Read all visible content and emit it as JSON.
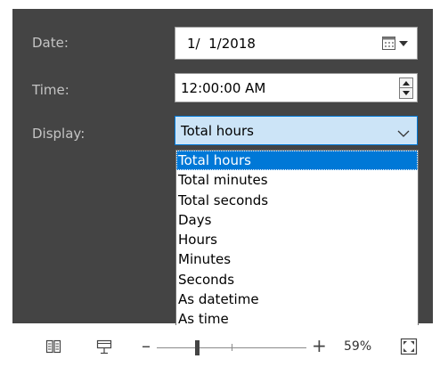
{
  "form": {
    "date_label": "Date:",
    "date_value": "1/  1/2018",
    "time_label": "Time:",
    "time_value": "12:00:00 AM",
    "display_label": "Display:",
    "display_value": "Total hours",
    "display_options": [
      "Total hours",
      "Total minutes",
      "Total seconds",
      "Days",
      "Hours",
      "Minutes",
      "Seconds",
      "As datetime",
      "As time"
    ]
  },
  "statusbar": {
    "zoom_minus": "–",
    "zoom_plus": "+",
    "zoom_percent": "59%",
    "zoom_fraction": 0.59
  },
  "colors": {
    "panel": "#444444",
    "accent": "#0078d7",
    "selected_field": "#cce4f7"
  },
  "icons": {
    "date_picker": "calendar-dropdown-icon",
    "spinner": "spin-up-down-icon",
    "select_chevron": "chevron-down-icon",
    "reading_view": "book-icon",
    "presenter": "presenter-icon",
    "fit": "fit-to-window-icon"
  }
}
